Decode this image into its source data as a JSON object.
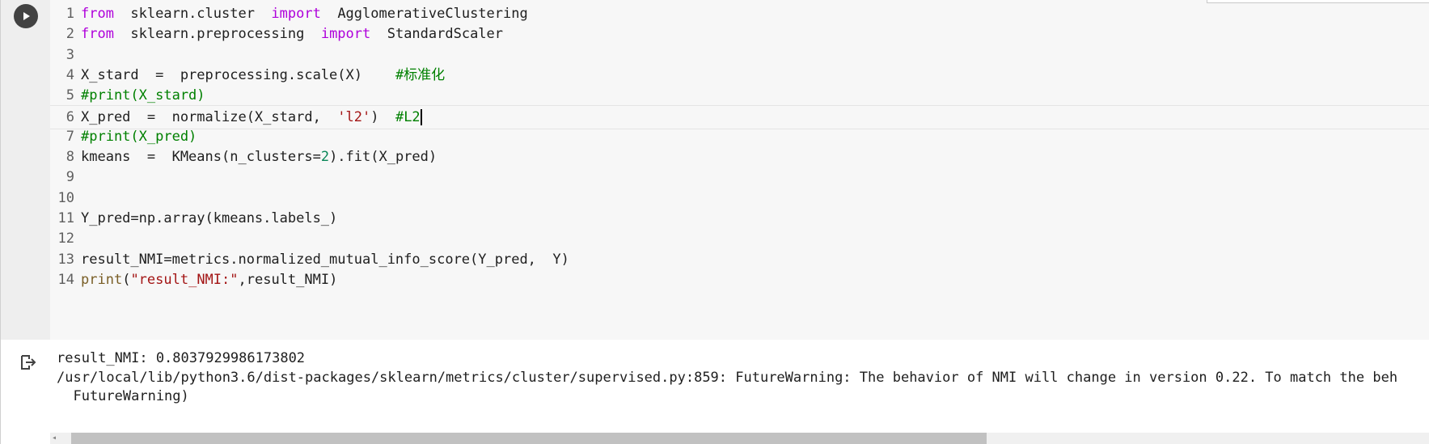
{
  "code_lines": [
    {
      "n": "1",
      "parts": [
        [
          "kw",
          "from"
        ],
        [
          "",
          "  sklearn.cluster  "
        ],
        [
          "kw",
          "import"
        ],
        [
          "",
          "  AgglomerativeClustering"
        ]
      ]
    },
    {
      "n": "2",
      "parts": [
        [
          "kw",
          "from"
        ],
        [
          "",
          "  sklearn.preprocessing  "
        ],
        [
          "kw",
          "import"
        ],
        [
          "",
          "  StandardScaler"
        ]
      ]
    },
    {
      "n": "3",
      "parts": []
    },
    {
      "n": "4",
      "parts": [
        [
          "",
          "X_stard  =  preprocessing.scale(X)    "
        ],
        [
          "cm-bright",
          "#标准化"
        ]
      ]
    },
    {
      "n": "5",
      "parts": [
        [
          "cm-bright",
          "#print(X_stard)"
        ]
      ]
    },
    {
      "n": "6",
      "parts": [
        [
          "",
          "X_pred  =  normalize(X_stard,  "
        ],
        [
          "str",
          "'l2'"
        ],
        [
          "",
          ")  "
        ],
        [
          "cm-bright",
          "#L2"
        ]
      ]
    },
    {
      "n": "7",
      "parts": [
        [
          "cm-bright",
          "#print(X_pred)"
        ]
      ]
    },
    {
      "n": "8",
      "parts": [
        [
          "",
          "kmeans  =  KMeans(n_clusters="
        ],
        [
          "num",
          "2"
        ],
        [
          "",
          ").fit(X_pred)"
        ]
      ]
    },
    {
      "n": "9",
      "parts": []
    },
    {
      "n": "10",
      "parts": []
    },
    {
      "n": "11",
      "parts": [
        [
          "",
          "Y_pred=np.array(kmeans.labels_)"
        ]
      ]
    },
    {
      "n": "12",
      "parts": []
    },
    {
      "n": "13",
      "parts": [
        [
          "",
          "result_NMI=metrics.normalized_mutual_info_score(Y_pred,  Y)"
        ]
      ]
    },
    {
      "n": "14",
      "parts": [
        [
          "fn",
          "print"
        ],
        [
          "",
          "("
        ],
        [
          "str",
          "\"result_NMI:\""
        ],
        [
          "",
          ",result_NMI)"
        ]
      ]
    }
  ],
  "output": {
    "line1": "result_NMI: 0.8037929986173802",
    "line2": "/usr/local/lib/python3.6/dist-packages/sklearn/metrics/cluster/supervised.py:859: FutureWarning: The behavior of NMI will change in version 0.22. To match the beh",
    "line3": "  FutureWarning)"
  },
  "icons": {
    "run": "play-icon",
    "output": "output-redirect-icon"
  }
}
